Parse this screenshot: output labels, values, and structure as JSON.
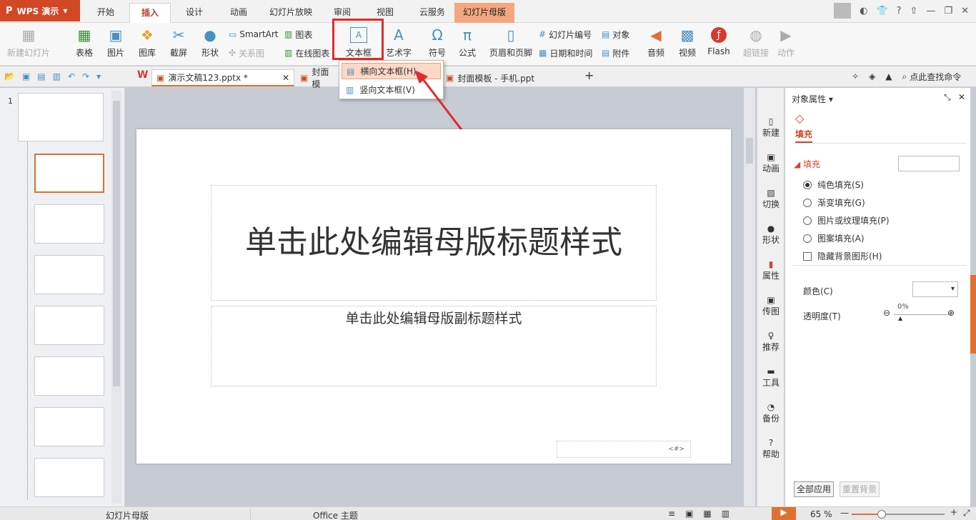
{
  "app": {
    "logo": "WPS 演示"
  },
  "tabs": [
    "开始",
    "插入",
    "设计",
    "动画",
    "幻灯片放映",
    "审阅",
    "视图",
    "云服务",
    "幻灯片母版"
  ],
  "ribbon": {
    "new_slide": "新建幻灯片",
    "table": "表格",
    "picture": "图片",
    "gallery": "图库",
    "screenshot": "截屏",
    "shape": "形状",
    "smartart": "SmartArt",
    "chart": "图表",
    "relation": "关系图",
    "online_chart": "在线图表",
    "textbox": "文本框",
    "wordart": "艺术字",
    "symbol": "符号",
    "formula": "公式",
    "header_footer": "页眉和页脚",
    "slide_number": "幻灯片编号",
    "date_time": "日期和时间",
    "object": "对象",
    "attachment": "附件",
    "audio": "音频",
    "video": "视频",
    "flash": "Flash",
    "hyperlink": "超链接",
    "action": "动作"
  },
  "doc_tabs": {
    "tab1": "演示文稿123.pptx *",
    "tab2": "封面模",
    "tab3": "封面模板 - 手机.ppt",
    "search": "点此查找命令"
  },
  "dropdown": {
    "horizontal": "横向文本框(H)",
    "vertical": "竖向文本框(V)"
  },
  "slide": {
    "title": "单击此处编辑母版标题样式",
    "subtitle": "单击此处编辑母版副标题样式",
    "page_num": "<#>"
  },
  "thumbnails": {
    "first_num": "1"
  },
  "sidebar": [
    "新建",
    "动画",
    "切换",
    "形状",
    "属性",
    "传图",
    "推荐",
    "工具",
    "备份",
    "帮助"
  ],
  "props": {
    "header": "对象属性",
    "fill_tab": "填充",
    "section": "填充",
    "opt_solid": "纯色填充(S)",
    "opt_gradient": "渐变填充(G)",
    "opt_picture": "图片或纹理填充(P)",
    "opt_pattern": "图案填充(A)",
    "opt_hide": "隐藏背景图形(H)",
    "color_label": "颜色(C)",
    "transparency_label": "透明度(T)",
    "transparency_value": "0%",
    "apply_all": "全部应用",
    "reset": "重置背景"
  },
  "status": {
    "mode": "幻灯片母版",
    "theme": "Office 主题",
    "zoom": "65 %"
  },
  "colors": {
    "accent": "#d24726",
    "highlight_box": "#e02b2b"
  }
}
